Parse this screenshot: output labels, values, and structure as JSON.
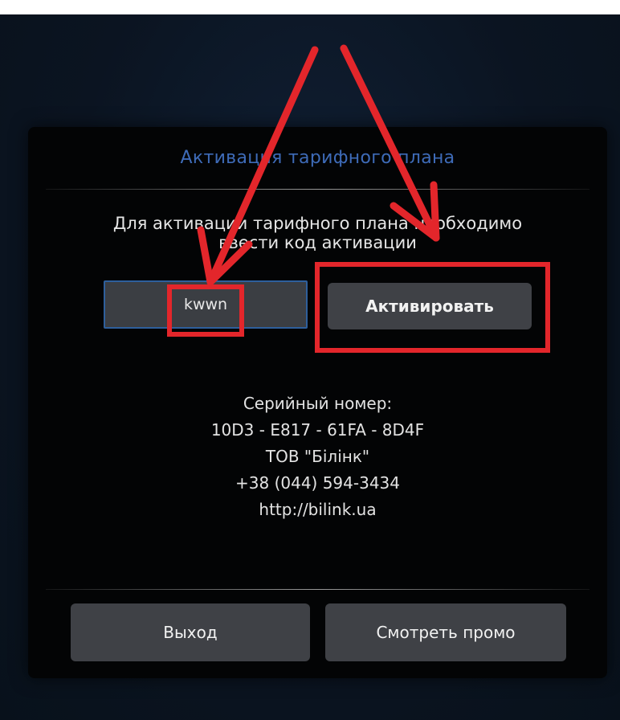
{
  "dialog": {
    "title": "Активация тарифного плана",
    "instruction_line1": "Для активации тарифного плана необходимо",
    "instruction_line2": "ввести код активации",
    "code_input": {
      "value": "kwwn",
      "placeholder": ""
    },
    "activate_label": "Активировать",
    "serial_label": "Серийный номер:",
    "serial_number": "10D3 - E817 - 61FA - 8D4F",
    "company": "ТОВ \"Білінк\"",
    "phone": "+38 (044) 594-3434",
    "website": "http://bilink.ua",
    "exit_label": "Выход",
    "promo_label": "Смотреть промо"
  },
  "annotation": {
    "arrow_color": "#e3262b",
    "highlight_color": "#e3262b",
    "icon": "red-arrow-icon"
  },
  "colors": {
    "background": "#0c1522",
    "dialog": "#030405",
    "title": "#3e6bb8",
    "button": "#3f4146",
    "input_border": "#2e5f9c"
  }
}
